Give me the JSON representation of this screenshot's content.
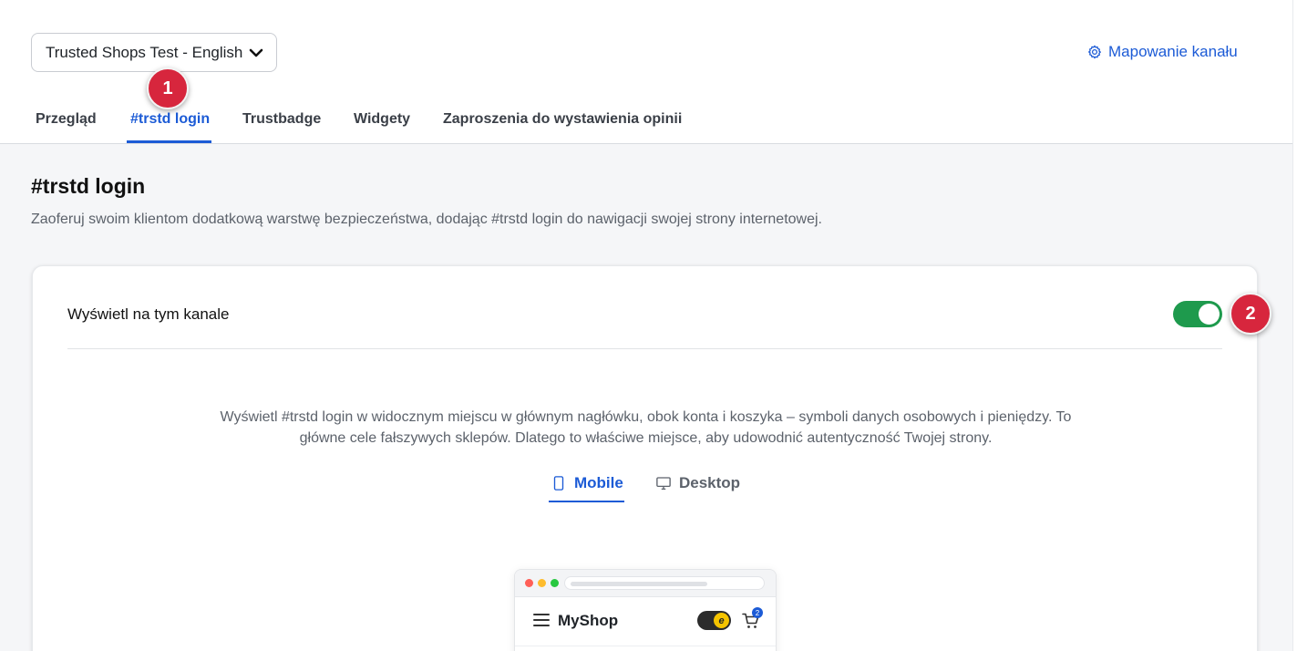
{
  "header": {
    "channel_selector": {
      "value": "Trusted Shops Test - English",
      "icon": "chevron-down-icon"
    },
    "mapping_link": {
      "label": "Mapowanie kanału",
      "icon": "gear-icon"
    }
  },
  "tabs": [
    {
      "label": "Przegląd",
      "active": false
    },
    {
      "label": "#trstd login",
      "active": true
    },
    {
      "label": "Trustbadge",
      "active": false
    },
    {
      "label": "Widgety",
      "active": false
    },
    {
      "label": "Zaproszenia do wystawienia opinii",
      "active": false
    }
  ],
  "annotations": {
    "badge_1": "1",
    "badge_2": "2",
    "badge_color": "#d7263d"
  },
  "page": {
    "title": "#trstd login",
    "description": "Zaoferuj swoim klientom dodatkową warstwę bezpieczeństwa, dodając #trstd login do nawigacji swojej strony internetowej."
  },
  "card": {
    "display_toggle": {
      "label": "Wyświetl na tym kanale",
      "enabled": true,
      "color": "#1e9a4d"
    },
    "info_text": "Wyświetl #trstd login w widocznym miejscu w głównym nagłówku, obok konta i koszyka – symboli danych osobowych i pieniędzy. To główne cele fałszywych sklepów. Dlatego to właściwe miejsce, aby udowodnić autentyczność Twojej strony.",
    "device_tabs": [
      {
        "label": "Mobile",
        "icon": "smartphone-icon",
        "active": true
      },
      {
        "label": "Desktop",
        "icon": "monitor-icon",
        "active": false
      }
    ],
    "preview": {
      "shop_name": "MyShop",
      "cart_count": "2",
      "login_badge_glyph": "e",
      "icons": [
        "hamburger-menu-icon",
        "trstd-login-toggle-icon",
        "cart-icon"
      ]
    }
  },
  "colors": {
    "accent": "#1c5bd6",
    "toggle_on": "#1e9a4d"
  }
}
